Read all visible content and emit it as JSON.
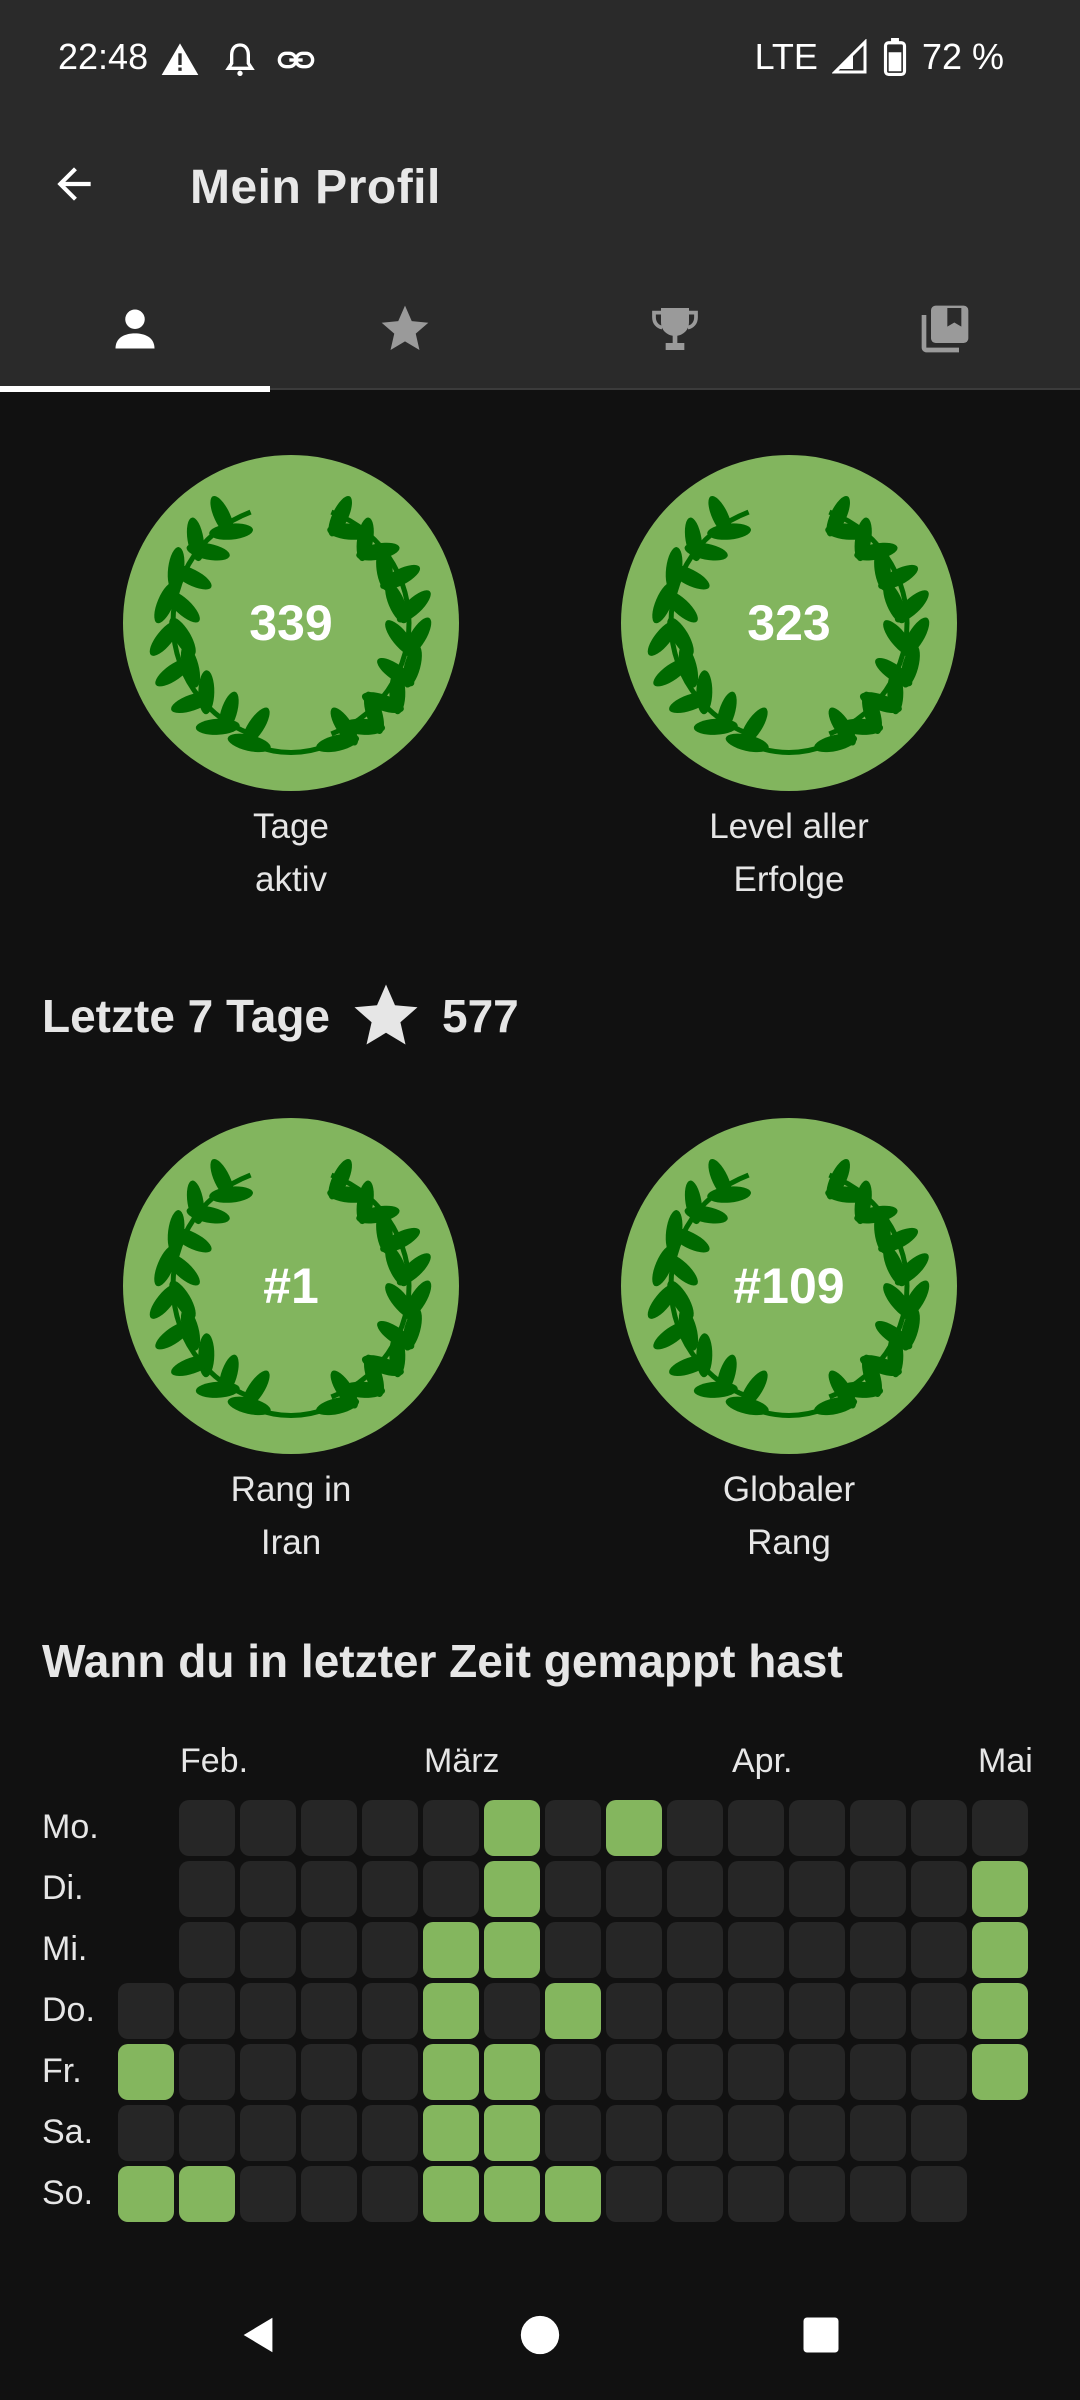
{
  "status_bar": {
    "time": "22:48",
    "network": "LTE",
    "battery": "72 %"
  },
  "app_bar": {
    "title": "Mein Profil"
  },
  "tabs": [
    {
      "icon": "person-icon",
      "selected": true
    },
    {
      "icon": "star-icon",
      "selected": false
    },
    {
      "icon": "trophy-icon",
      "selected": false
    },
    {
      "icon": "library-icon",
      "selected": false
    }
  ],
  "colors": {
    "badge_fill": "#82b55e",
    "laurel": "#006a00",
    "active_cell": "#84b65e",
    "empty_cell": "#262626",
    "background": "#111111",
    "bar": "#2a2a2a"
  },
  "stats": [
    {
      "value": "339",
      "label_line1": "Tage",
      "label_line2": "aktiv"
    },
    {
      "value": "323",
      "label_line1": "Level aller",
      "label_line2": "Erfolge"
    }
  ],
  "week": {
    "label": "Letzte 7 Tage",
    "points": "577"
  },
  "ranks": [
    {
      "value": "#1",
      "label_line1": "Rang in",
      "label_line2": "Iran"
    },
    {
      "value": "#109",
      "label_line1": "Globaler",
      "label_line2": "Rang"
    }
  ],
  "activity": {
    "title": "Wann du in letzter Zeit gemappt hast",
    "months": [
      "Feb.",
      "März",
      "Apr.",
      "Mai"
    ],
    "days": [
      "Mo.",
      "Di.",
      "Mi.",
      "Do.",
      "Fr.",
      "Sa.",
      "So."
    ],
    "week_count": 15,
    "grid": [
      [
        null,
        0,
        0,
        0,
        0,
        0,
        1,
        0,
        1,
        0,
        0,
        0,
        0,
        0,
        0
      ],
      [
        null,
        0,
        0,
        0,
        0,
        0,
        1,
        0,
        0,
        0,
        0,
        0,
        0,
        0,
        1
      ],
      [
        null,
        0,
        0,
        0,
        0,
        1,
        1,
        0,
        0,
        0,
        0,
        0,
        0,
        0,
        1
      ],
      [
        0,
        0,
        0,
        0,
        0,
        1,
        0,
        1,
        0,
        0,
        0,
        0,
        0,
        0,
        1
      ],
      [
        1,
        0,
        0,
        0,
        0,
        1,
        1,
        0,
        0,
        0,
        0,
        0,
        0,
        0,
        1
      ],
      [
        0,
        0,
        0,
        0,
        0,
        1,
        1,
        0,
        0,
        0,
        0,
        0,
        0,
        0,
        null
      ],
      [
        1,
        1,
        0,
        0,
        0,
        1,
        1,
        1,
        0,
        0,
        0,
        0,
        0,
        0,
        null
      ]
    ]
  }
}
